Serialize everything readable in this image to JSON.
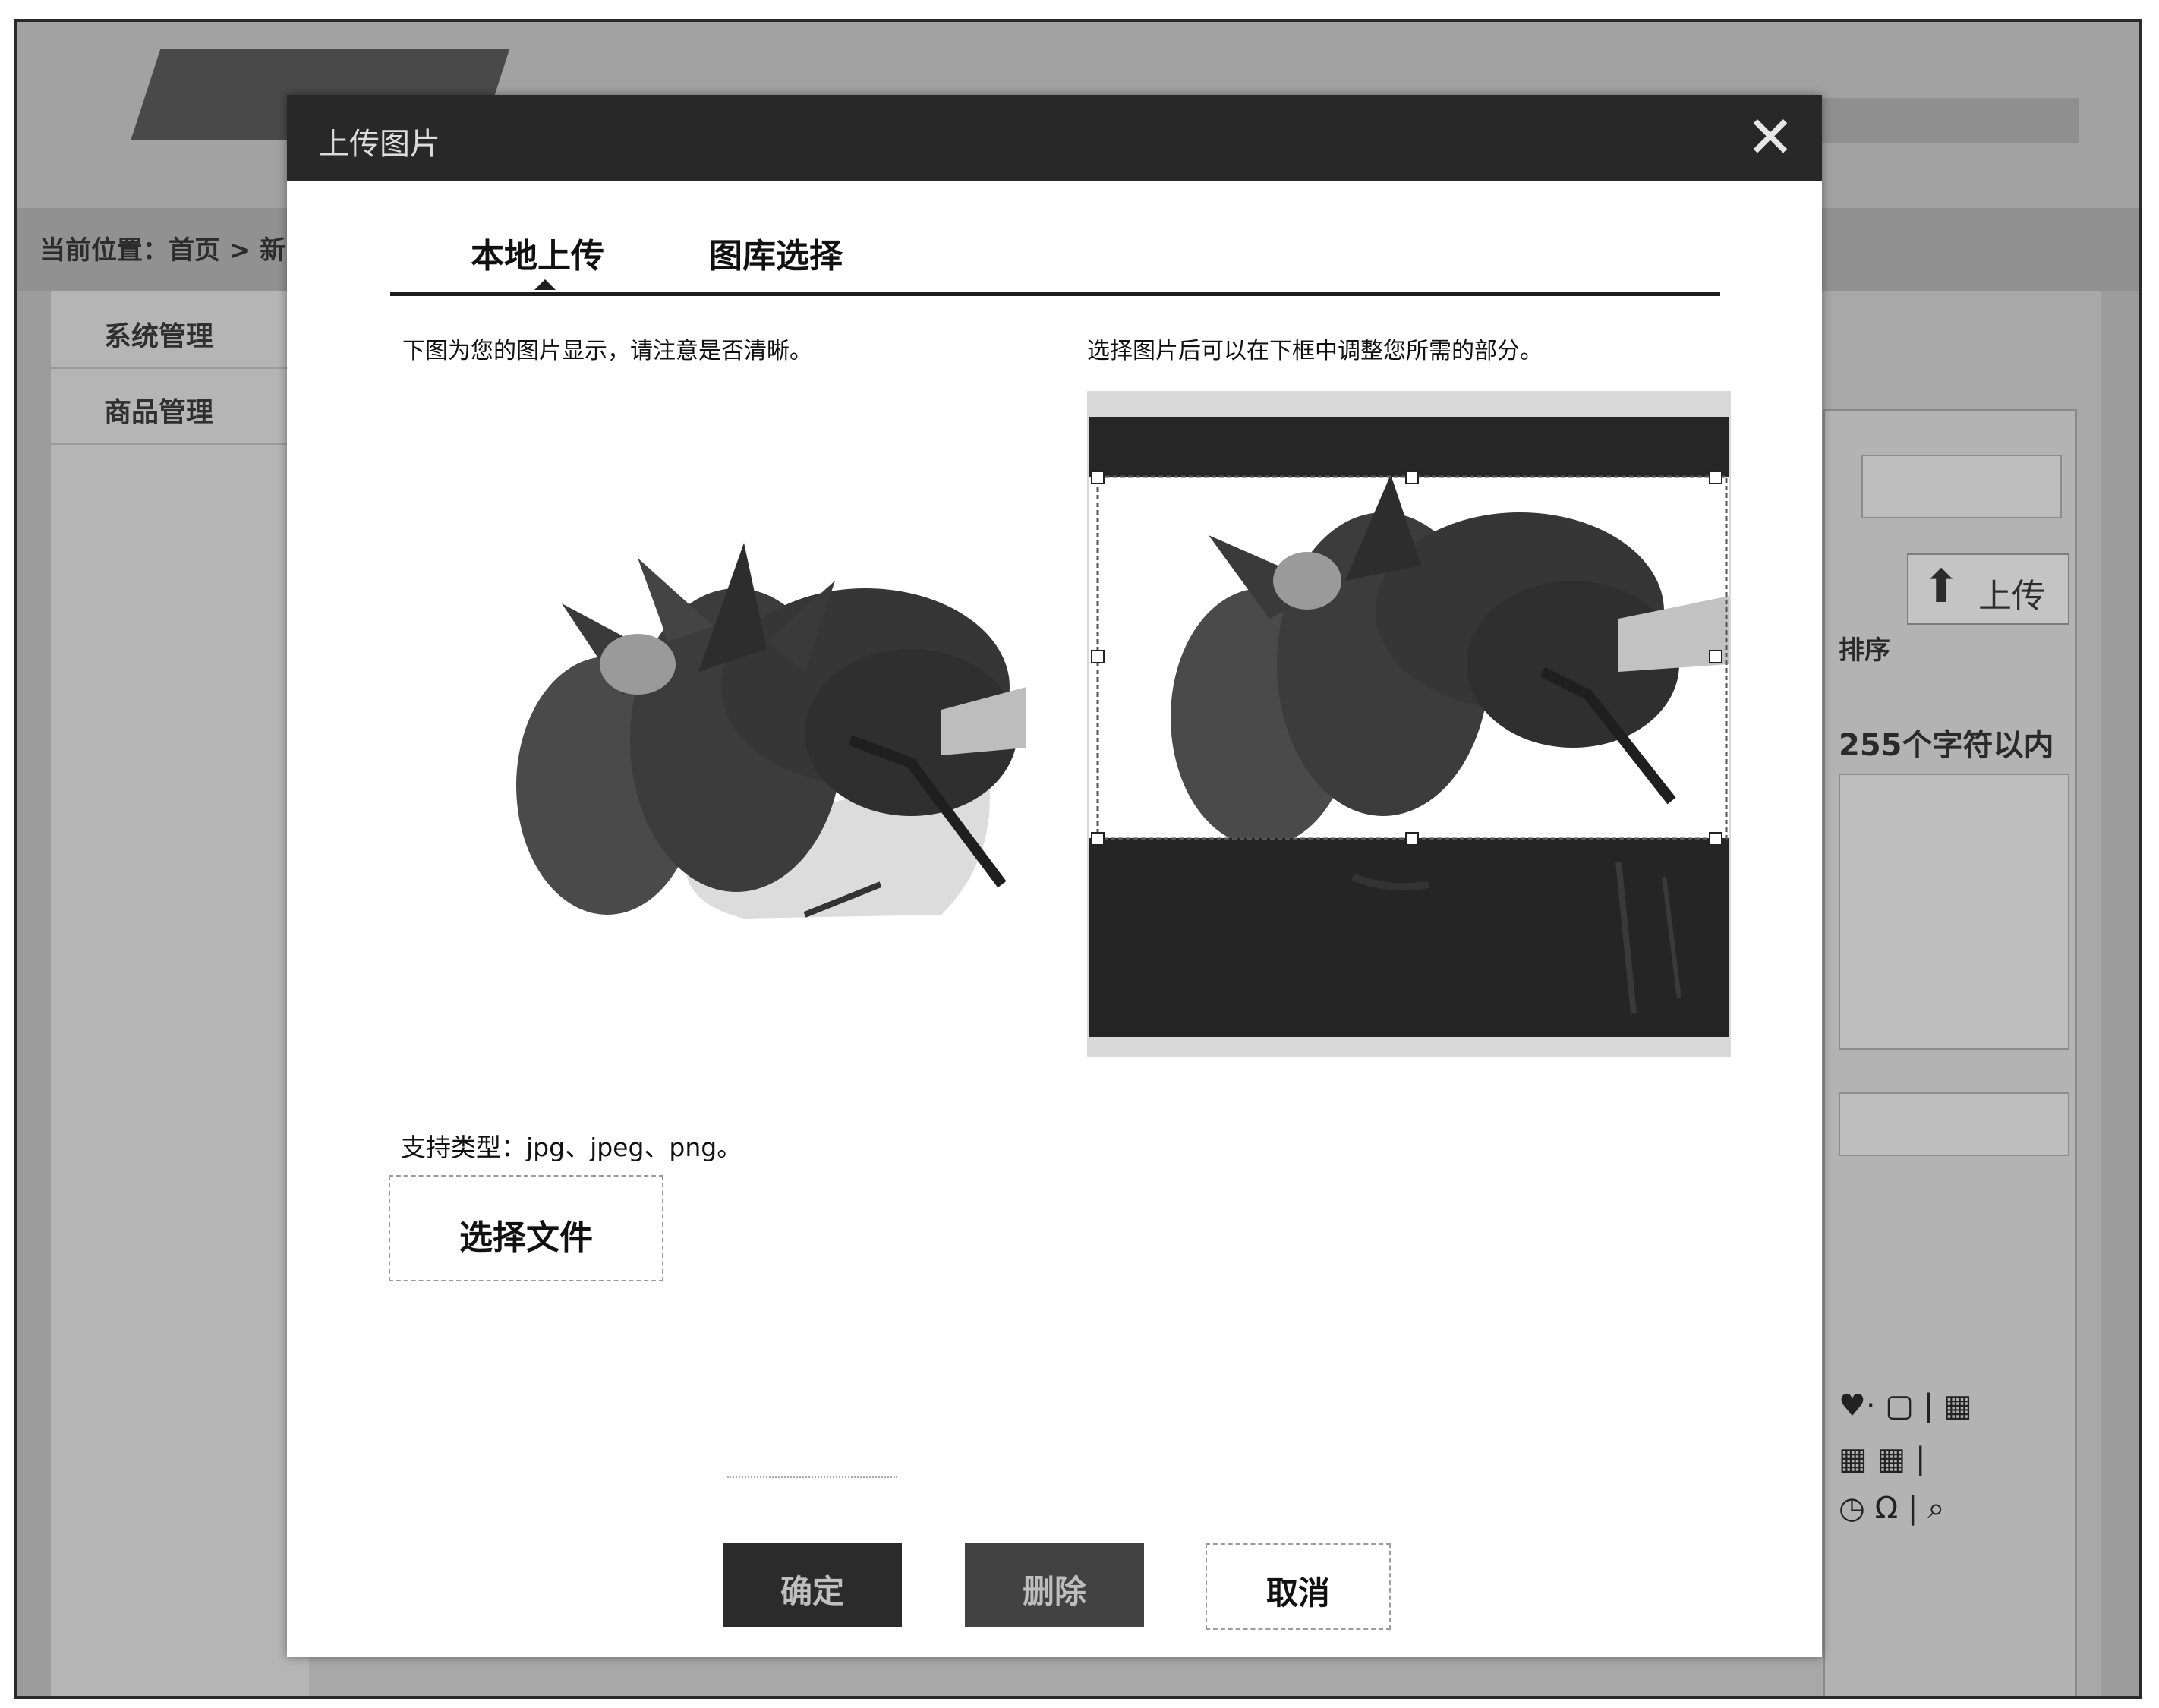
{
  "background": {
    "breadcrumb": "当前位置：首页 > 新",
    "sidebar_items": [
      "系统管理",
      "商品管理"
    ],
    "upload_button_label": "上传",
    "partial_label": "排序",
    "char_limit_hint": "255个字符以内",
    "toolbar_row1": "♥· ▢ | ▦",
    "toolbar_row2": "▦ ▦ |",
    "toolbar_row3": "◷ Ω | ⌕"
  },
  "modal": {
    "title": "上传图片",
    "close_glyph": "✕",
    "tabs": [
      "本地上传",
      "图库选择"
    ],
    "left_hint": "下图为您的图片显示，请注意是否清晰。",
    "right_hint": "选择图片后可以在下框中调整您所需的部分。",
    "supported_types": "支持类型：jpg、jpeg、png。",
    "choose_file_label": "选择文件",
    "buttons": {
      "confirm": "确定",
      "delete": "删除",
      "cancel": "取消"
    }
  }
}
